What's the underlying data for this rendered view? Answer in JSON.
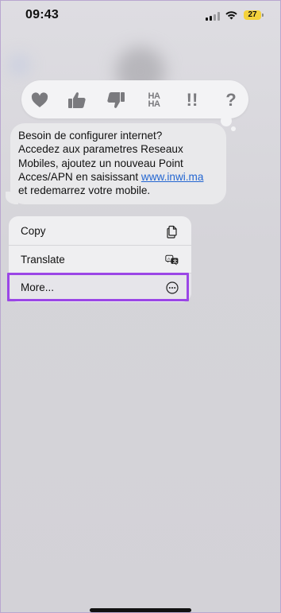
{
  "status_bar": {
    "time": "09:43",
    "battery": "27"
  },
  "tapback": {
    "reactions": [
      "heart-icon",
      "thumbs-up-icon",
      "thumbs-down-icon",
      "haha",
      "exclamation",
      "question"
    ],
    "haha_line1": "HA",
    "haha_line2": "HA",
    "exclaim": "!!",
    "question": "?"
  },
  "message": {
    "line1": "Besoin de configurer internet?",
    "line2": "Accedez aux parametres Reseaux",
    "line3": "Mobiles, ajoutez un nouveau Point",
    "line4_prefix": "Acces/APN en saisissant ",
    "link": "www.inwi.ma",
    "line5": "et redemarrez votre mobile."
  },
  "menu": {
    "copy": "Copy",
    "translate": "Translate",
    "more": "More..."
  },
  "colors": {
    "highlight": "#9b46e6",
    "link": "#2366d1",
    "battery": "#f4d23c"
  }
}
